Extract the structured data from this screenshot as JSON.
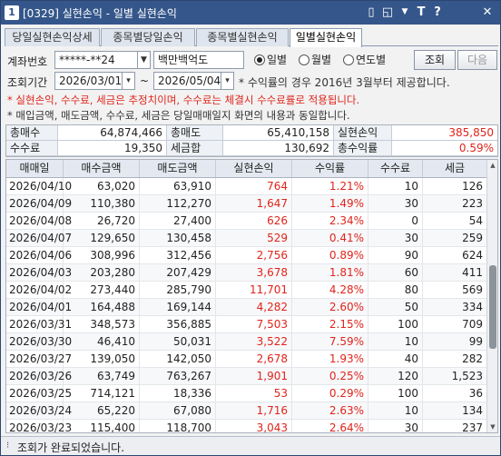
{
  "window": {
    "number": "1",
    "title": "[0329] 실현손익 - 일별 실현손익",
    "buttons": {
      "pin": "▯",
      "restore": "◱",
      "settings": "▼",
      "font": "T",
      "help": "?",
      "close": "✕"
    }
  },
  "tabs": [
    {
      "label": "당일실현손익상세",
      "active": false
    },
    {
      "label": "종목별당일손익",
      "active": false
    },
    {
      "label": "종목별실현손익",
      "active": false
    },
    {
      "label": "일별실현손익",
      "active": true
    }
  ],
  "form": {
    "account_label": "계좌번호",
    "account_value": "*****-**24",
    "account_name": "백만백억도",
    "period_label": "조회기간",
    "date_from": "2026/03/01",
    "date_to": "2026/05/04",
    "tilde": "~",
    "period_note": "* 수익률의 경우 2016년 3월부터 제공합니다.",
    "radio": [
      {
        "label": "일별",
        "selected": true
      },
      {
        "label": "월별",
        "selected": false
      },
      {
        "label": "연도별",
        "selected": false
      }
    ],
    "search_button": "조회",
    "next_button": "다음"
  },
  "notes": {
    "red": "* 실현손익, 수수료, 세금은 추정치이며, 수수료는 체결시 수수료률로 적용됩니다.",
    "dark": "* 매입금액, 매도금액, 수수료, 세금은 당일매매일지 화면의 내용과 동일합니다."
  },
  "summary": {
    "total_buy_label": "총매수",
    "total_buy": "64,874,466",
    "total_sell_label": "총매도",
    "total_sell": "65,410,158",
    "realized_label": "실현손익",
    "realized": "385,850",
    "fee_label": "수수료",
    "fee": "19,350",
    "tax_label": "세금합",
    "tax": "130,692",
    "return_label": "총수익률",
    "return": "0.59%"
  },
  "table": {
    "headers": [
      "매매일",
      "매수금액",
      "매도금액",
      "실현손익",
      "수익률",
      "수수료",
      "세금"
    ],
    "rows": [
      [
        "2026/04/10",
        "63,020",
        "63,910",
        "764",
        "1.21%",
        "10",
        "126"
      ],
      [
        "2026/04/09",
        "110,380",
        "112,270",
        "1,647",
        "1.49%",
        "30",
        "223"
      ],
      [
        "2026/04/08",
        "26,720",
        "27,400",
        "626",
        "2.34%",
        "0",
        "54"
      ],
      [
        "2026/04/07",
        "129,650",
        "130,458",
        "529",
        "0.41%",
        "30",
        "259"
      ],
      [
        "2026/04/06",
        "308,996",
        "312,456",
        "2,756",
        "0.89%",
        "90",
        "624"
      ],
      [
        "2026/04/03",
        "203,280",
        "207,429",
        "3,678",
        "1.81%",
        "60",
        "411"
      ],
      [
        "2026/04/02",
        "273,440",
        "285,790",
        "11,701",
        "4.28%",
        "80",
        "569"
      ],
      [
        "2026/04/01",
        "164,488",
        "169,144",
        "4,282",
        "2.60%",
        "50",
        "334"
      ],
      [
        "2026/03/31",
        "348,573",
        "356,885",
        "7,503",
        "2.15%",
        "100",
        "709"
      ],
      [
        "2026/03/30",
        "46,410",
        "50,031",
        "3,522",
        "7.59%",
        "10",
        "99"
      ],
      [
        "2026/03/27",
        "139,050",
        "142,050",
        "2,678",
        "1.93%",
        "40",
        "282"
      ],
      [
        "2026/03/26",
        "63,749",
        "763,267",
        "1,901",
        "0.25%",
        "120",
        "1,523"
      ],
      [
        "2026/03/25",
        "714,121",
        "18,336",
        "53",
        "0.29%",
        "100",
        "36"
      ],
      [
        "2026/03/24",
        "65,220",
        "67,080",
        "1,716",
        "2.63%",
        "10",
        "134"
      ],
      [
        "2026/03/23",
        "115,400",
        "118,700",
        "3,043",
        "2.64%",
        "30",
        "237"
      ]
    ]
  },
  "status": {
    "text": "조회가 완료되었습니다."
  },
  "colors": {
    "profit": "#e0241b",
    "titlebar": "#34568a"
  }
}
